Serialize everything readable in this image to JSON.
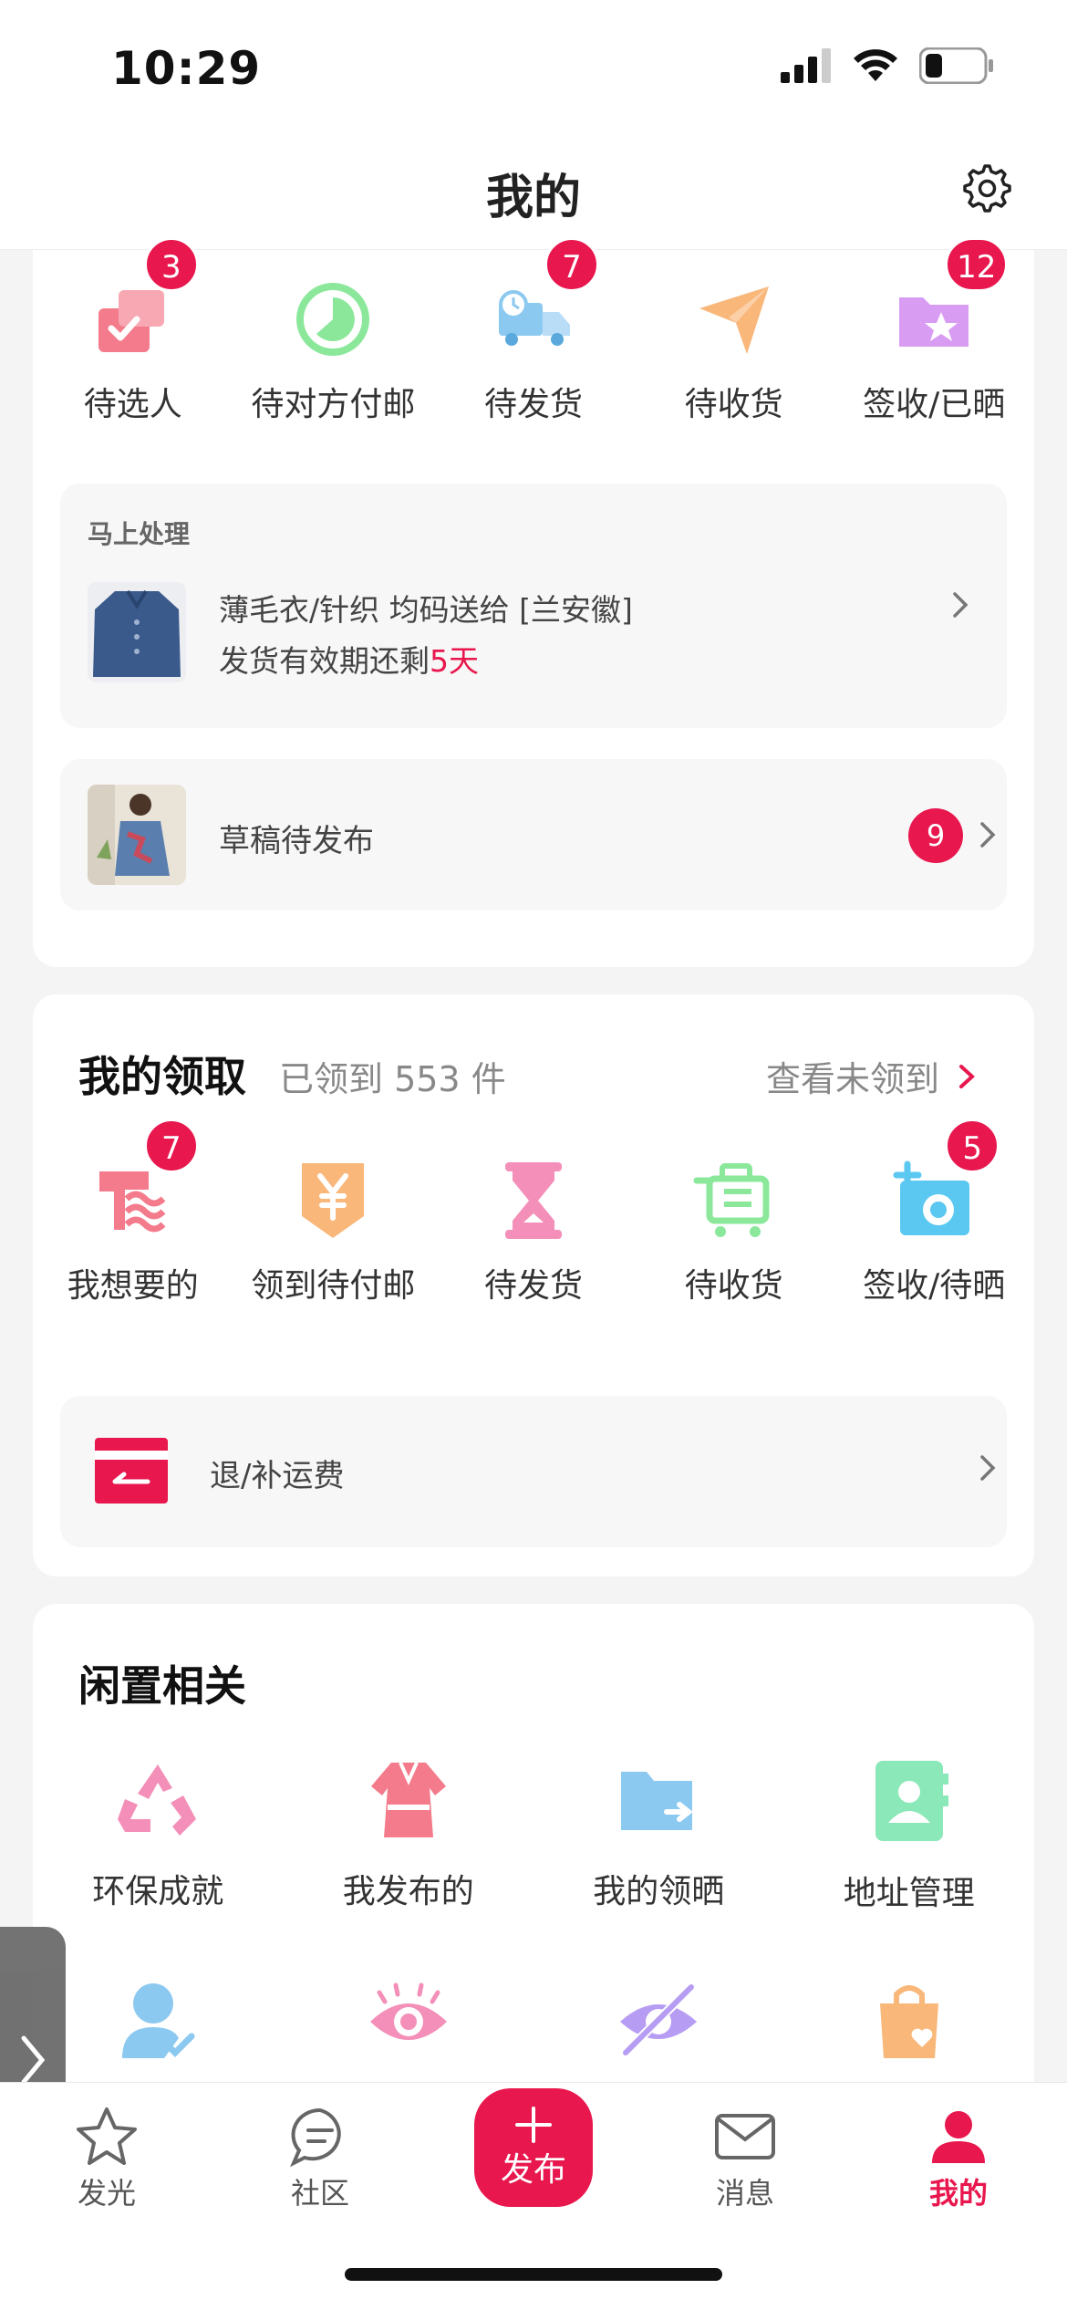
{
  "status_bar": {
    "time": "10:29"
  },
  "header": {
    "title": "我的"
  },
  "orders": {
    "items": [
      {
        "label": "待选人",
        "badge": "3",
        "icon": "gift-check-icon",
        "color": "#f47b8b"
      },
      {
        "label": "待对方付邮",
        "badge": "",
        "icon": "clock-circle-icon",
        "color": "#8be89b"
      },
      {
        "label": "待发货",
        "badge": "7",
        "icon": "delivery-truck-icon",
        "color": "#8cc9f0"
      },
      {
        "label": "待收货",
        "badge": "",
        "icon": "paper-plane-icon",
        "color": "#f9b77a"
      },
      {
        "label": "签收/已晒",
        "badge": "12",
        "icon": "folder-star-icon",
        "color": "#d99cf3"
      }
    ],
    "urgent": {
      "header": "马上处理",
      "title": "薄毛衣/针织 均码送给 [兰安徽]",
      "subtitle_prefix": "发货有效期还剩",
      "subtitle_highlight": "5天"
    },
    "draft": {
      "label": "草稿待发布",
      "count": "9"
    }
  },
  "claims": {
    "title": "我的领取",
    "count_text": "已领到 553 件",
    "link": "查看未领到",
    "items": [
      {
        "label": "我想要的",
        "badge": "7",
        "icon": "shirt-heart-icon",
        "color": "#f47b8b"
      },
      {
        "label": "领到待付邮",
        "badge": "",
        "icon": "yen-tag-icon",
        "color": "#f9b77a"
      },
      {
        "label": "待发货",
        "badge": "",
        "icon": "hourglass-icon",
        "color": "#f38fb8"
      },
      {
        "label": "待收货",
        "badge": "",
        "icon": "trolley-icon",
        "color": "#8be89b"
      },
      {
        "label": "签收/待晒",
        "badge": "5",
        "icon": "camera-plus-icon",
        "color": "#5ac8f0"
      }
    ],
    "refund": {
      "label": "退/补运费"
    }
  },
  "idle": {
    "title": "闲置相关",
    "items": [
      {
        "label": "环保成就",
        "icon": "recycle-icon",
        "color": "#f38fb8"
      },
      {
        "label": "我发布的",
        "icon": "dress-icon",
        "color": "#f47b8b"
      },
      {
        "label": "我的领晒",
        "icon": "folder-share-icon",
        "color": "#8cc9f0"
      },
      {
        "label": "地址管理",
        "icon": "address-book-icon",
        "color": "#8be8b8"
      }
    ],
    "items_row2": [
      {
        "icon": "user-verified-icon",
        "color": "#8cc9f0"
      },
      {
        "icon": "eye-icon",
        "color": "#f38fb8"
      },
      {
        "icon": "eye-off-icon",
        "color": "#b69cf3"
      },
      {
        "icon": "shopping-bag-heart-icon",
        "color": "#f9b77a"
      }
    ]
  },
  "tabbar": {
    "items": [
      {
        "label": "发光",
        "icon": "star-icon"
      },
      {
        "label": "社区",
        "icon": "chat-bubble-icon"
      },
      {
        "label": "发布",
        "icon": "plus-icon"
      },
      {
        "label": "消息",
        "icon": "mail-icon"
      },
      {
        "label": "我的",
        "icon": "user-icon"
      }
    ]
  },
  "colors": {
    "accent": "#e8174e",
    "background": "#f4f4f4"
  }
}
